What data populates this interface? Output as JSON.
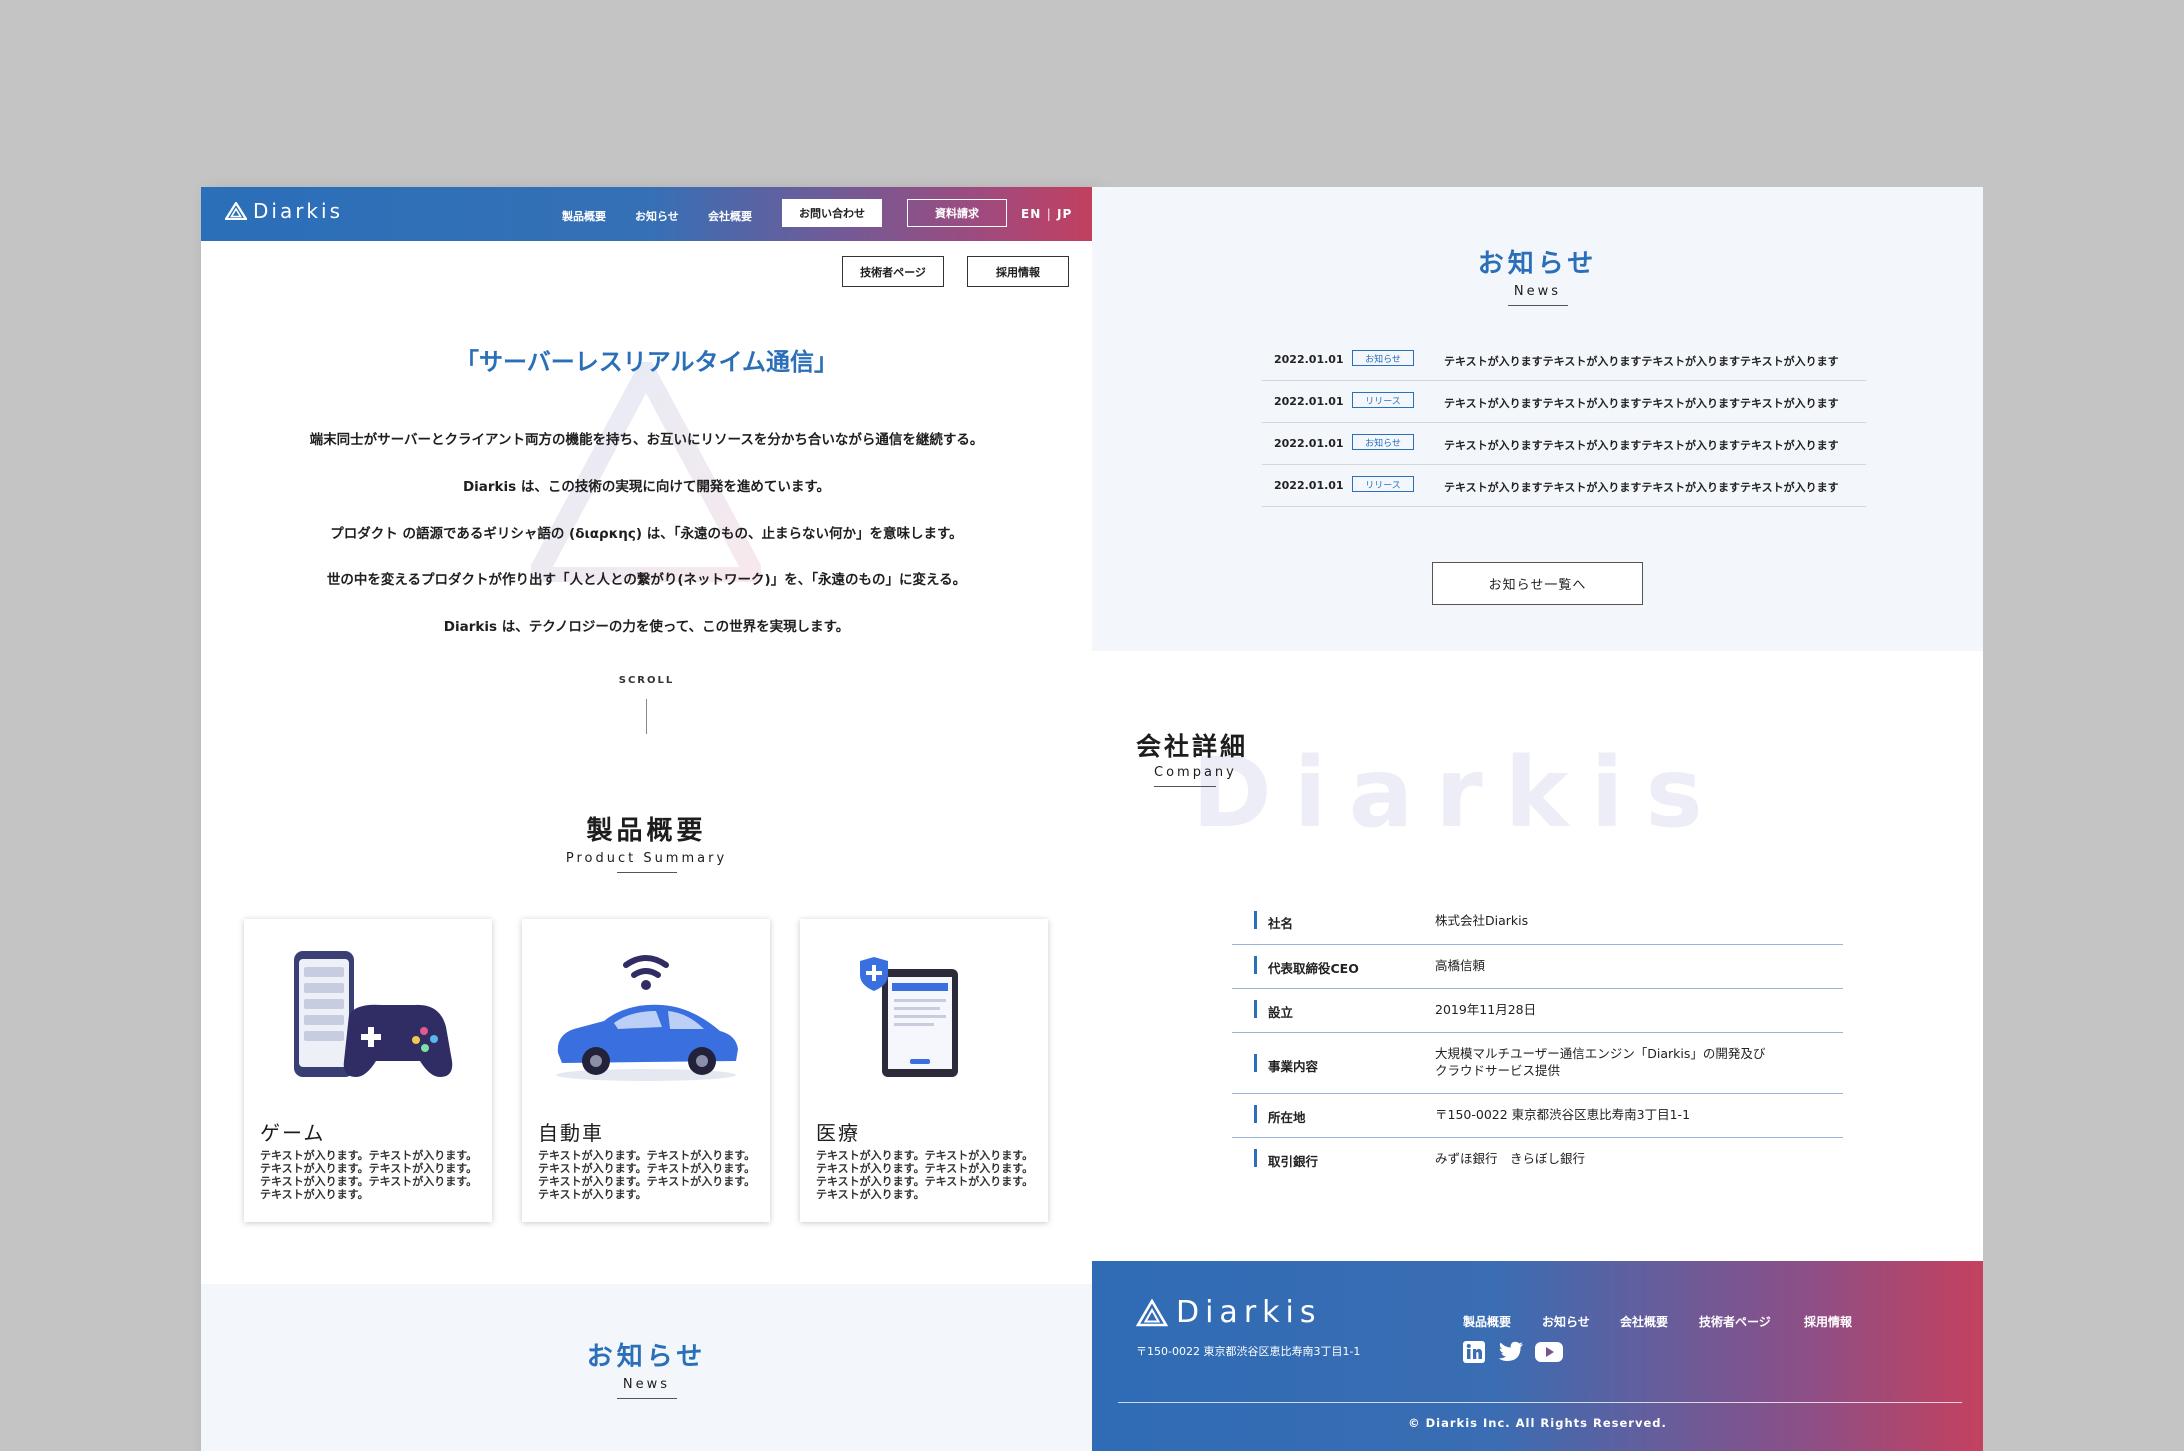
{
  "brand": "Diarkis",
  "header": {
    "nav": [
      "製品概要",
      "お知らせ",
      "会社概要"
    ],
    "contact_label": "お問い合わせ",
    "document_label": "資料請求",
    "lang_en": "EN",
    "lang_sep": "|",
    "lang_jp": "JP",
    "tech_page_label": "技術者ページ",
    "careers_label": "採用情報"
  },
  "hero": {
    "title": "「サーバーレスリアルタイム通信」",
    "lines": [
      "端末同士がサーバーとクライアント両方の機能を持ち、お互いにリソースを分かち合いながら通信を継続する。",
      "Diarkis は、この技術の実現に向けて開発を進めています。",
      "プロダクト の語源であるギリシャ語の (διαρκης) は、「永遠のもの、止まらない何か」を意味します。",
      "世の中を変えるプロダクトが作り出す「人と人との繋がり(ネットワーク)」を、「永遠のもの」に変える。",
      "Diarkis は、テクノロジーの力を使って、この世界を実現します。"
    ],
    "scroll_label": "SCROLL"
  },
  "products": {
    "title": "製品概要",
    "subtitle": "Product Summary",
    "cards": [
      {
        "name": "ゲーム",
        "desc": "テキストが入ります。テキストが入ります。テキストが入ります。テキストが入ります。テキストが入ります。テキストが入ります。テキストが入ります。"
      },
      {
        "name": "自動車",
        "desc": "テキストが入ります。テキストが入ります。テキストが入ります。テキストが入ります。テキストが入ります。テキストが入ります。テキストが入ります。"
      },
      {
        "name": "医療",
        "desc": "テキストが入ります。テキストが入ります。テキストが入ります。テキストが入ります。テキストが入ります。テキストが入ります。テキストが入ります。"
      }
    ]
  },
  "news": {
    "title": "お知らせ",
    "subtitle": "News",
    "items": [
      {
        "date": "2022.01.01",
        "tag": "お知らせ",
        "text": "テキストが入りますテキストが入りますテキストが入りますテキストが入ります"
      },
      {
        "date": "2022.01.01",
        "tag": "リリース",
        "text": "テキストが入りますテキストが入りますテキストが入りますテキストが入ります"
      },
      {
        "date": "2022.01.01",
        "tag": "お知らせ",
        "text": "テキストが入りますテキストが入りますテキストが入りますテキストが入ります"
      },
      {
        "date": "2022.01.01",
        "tag": "リリース",
        "text": "テキストが入りますテキストが入りますテキストが入りますテキストが入ります"
      }
    ],
    "more_label": "お知らせ一覧へ"
  },
  "company": {
    "title": "会社詳細",
    "subtitle": "Company",
    "watermark": "Diarkis",
    "rows": [
      {
        "key": "社名",
        "value": "株式会社Diarkis"
      },
      {
        "key": "代表取締役CEO",
        "value": "高橋信頼"
      },
      {
        "key": "設立",
        "value": "2019年11月28日"
      },
      {
        "key": "事業内容",
        "value": "大規模マルチユーザー通信エンジン「Diarkis」の開発及び",
        "value2": "クラウドサービス提供"
      },
      {
        "key": "所在地",
        "value": "〒150-0022 東京都渋谷区恵比寿南3丁目1-1"
      },
      {
        "key": "取引銀行",
        "value": "みずほ銀行　きらぼし銀行"
      }
    ]
  },
  "footer": {
    "address": "〒150-0022 東京都渋谷区恵比寿南3丁目1-1",
    "nav": [
      "製品概要",
      "お知らせ",
      "会社概要",
      "技術者ページ",
      "採用情報"
    ],
    "social_icons": [
      "linkedin-icon",
      "twitter-icon",
      "youtube-icon"
    ],
    "copyright": "© Diarkis Inc. All Rights Reserved."
  },
  "colors": {
    "brand_blue": "#2a6fb8",
    "brand_red": "#c2405f",
    "section_bg": "#f3f7fc"
  }
}
